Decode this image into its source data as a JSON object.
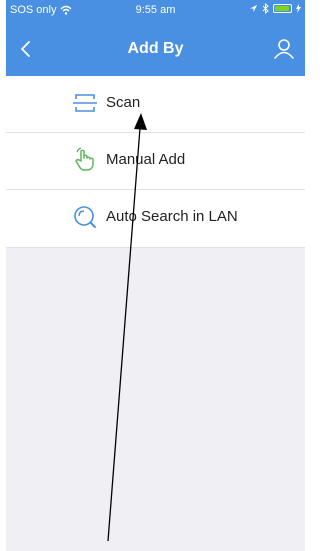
{
  "status_bar": {
    "carrier": "SOS only",
    "time": "9:55 am"
  },
  "nav": {
    "title": "Add By",
    "back_icon": "chevron-left-icon",
    "profile_icon": "user-icon"
  },
  "menu": {
    "items": [
      {
        "label": "Scan",
        "icon": "scan-icon",
        "icon_color": "#4a90e2"
      },
      {
        "label": "Manual Add",
        "icon": "hand-pointer-icon",
        "icon_color": "#5cb85c"
      },
      {
        "label": "Auto Search in LAN",
        "icon": "search-icon",
        "icon_color": "#4a90e2"
      }
    ]
  },
  "colors": {
    "accent": "#4a90e2",
    "background": "#efeff4",
    "battery": "#7ed321"
  }
}
